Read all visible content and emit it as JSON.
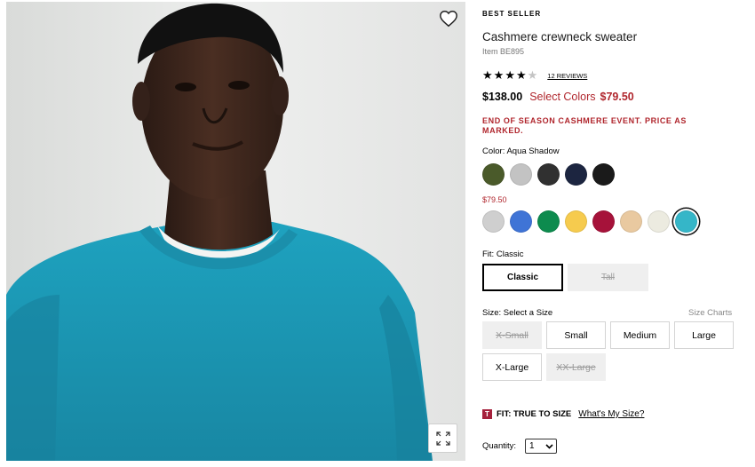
{
  "product": {
    "badge": "BEST SELLER",
    "title": "Cashmere crewneck sweater",
    "item_number": "Item BE895",
    "rating": 4,
    "rating_max": 5,
    "reviews_label": "12 REVIEWS",
    "price_original": "$138.00",
    "price_select_label": "Select Colors",
    "price_sale": "$79.50",
    "promo": "END OF SEASON CASHMERE EVENT. PRICE AS MARKED."
  },
  "color": {
    "label": "Color:",
    "selected_name": "Aqua Shadow",
    "full_price_swatches": [
      "#4a5a2a",
      "#c3c3c3",
      "#303030",
      "#1c2540",
      "#1a1a1a"
    ],
    "sale_price_label": "$79.50",
    "sale_swatches": [
      "#cfcfcf",
      "#3f74d6",
      "#0d8b4e",
      "#f6cb4e",
      "#a6123a",
      "#e9c9a0",
      "#ecebe0",
      "#35b6c8"
    ],
    "selected_index": 7
  },
  "fit": {
    "label": "Fit:",
    "selected": "Classic",
    "options": [
      "Classic",
      "Tall"
    ]
  },
  "size": {
    "label": "Size:",
    "selected": "Select a Size",
    "charts_label": "Size Charts",
    "options": [
      "X-Small",
      "Small",
      "Medium",
      "Large",
      "X-Large",
      "XX-Large"
    ],
    "unavailable": [
      "X-Small",
      "XX-Large"
    ]
  },
  "fit_note": {
    "badge": "T",
    "text": "FIT: TRUE TO SIZE",
    "link": "What's My Size?"
  },
  "quantity": {
    "label": "Quantity:",
    "value": "1"
  },
  "icons": {
    "wishlist": "heart-outline-icon",
    "zoom": "expand-icon"
  },
  "colors": {
    "sale_red": "#b0262d",
    "sweater_teal": "#1f98b5",
    "t_badge": "#a5213c"
  }
}
